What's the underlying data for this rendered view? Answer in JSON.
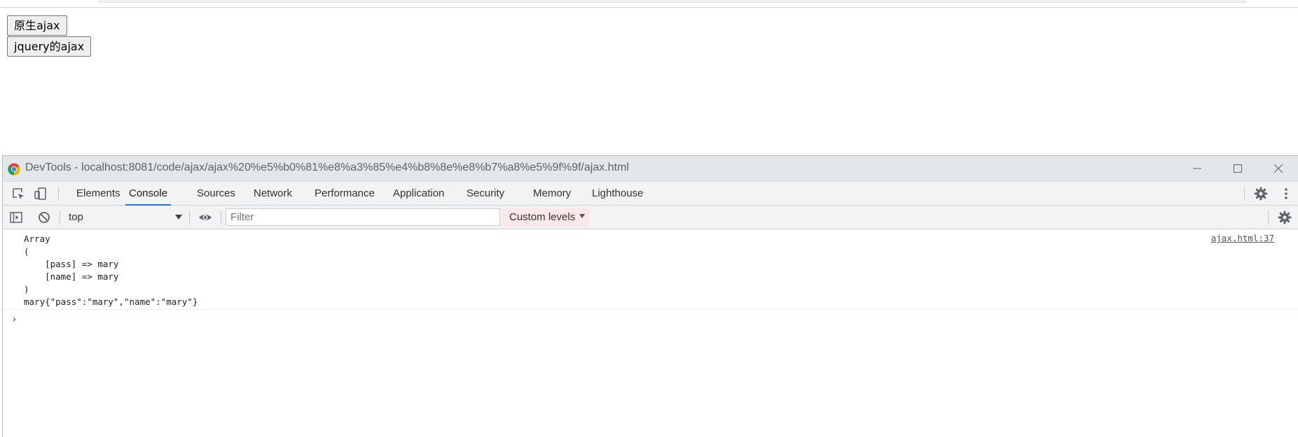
{
  "page": {
    "button_native": "原生ajax",
    "button_jquery": "jquery的ajax"
  },
  "devtools": {
    "window_title": "DevTools - localhost:8081/code/ajax/ajax%20%e5%b0%81%e8%a3%85%e4%b8%8e%e8%b7%a8%e5%9f%9f/ajax.html",
    "tabs": [
      "Elements",
      "Console",
      "Sources",
      "Network",
      "Performance",
      "Application",
      "Security",
      "Memory",
      "Lighthouse"
    ],
    "active_tab": "Console",
    "context": "top",
    "filter_placeholder": "Filter",
    "levels_label": "Custom levels",
    "messages": [
      {
        "text": "Array\n(\n    [pass] => mary\n    [name] => mary\n)\nmary{\"pass\":\"mary\",\"name\":\"mary\"}",
        "source": "ajax.html:37"
      }
    ],
    "prompt_symbol": "›"
  },
  "colors": {
    "accent": "#1a73e8",
    "levels_bg": "#fce8e6",
    "titlebar_bg": "#e3e7ea",
    "toolbar_bg": "#f1f3f4"
  },
  "icons": [
    "chrome-logo-icon",
    "minimize-icon",
    "maximize-icon",
    "close-icon",
    "inspect-element-icon",
    "device-toolbar-icon",
    "settings-gear-icon",
    "kebab-menu-icon",
    "sidebar-toggle-icon",
    "clear-console-icon",
    "eye-icon",
    "dropdown-arrow-icon"
  ]
}
